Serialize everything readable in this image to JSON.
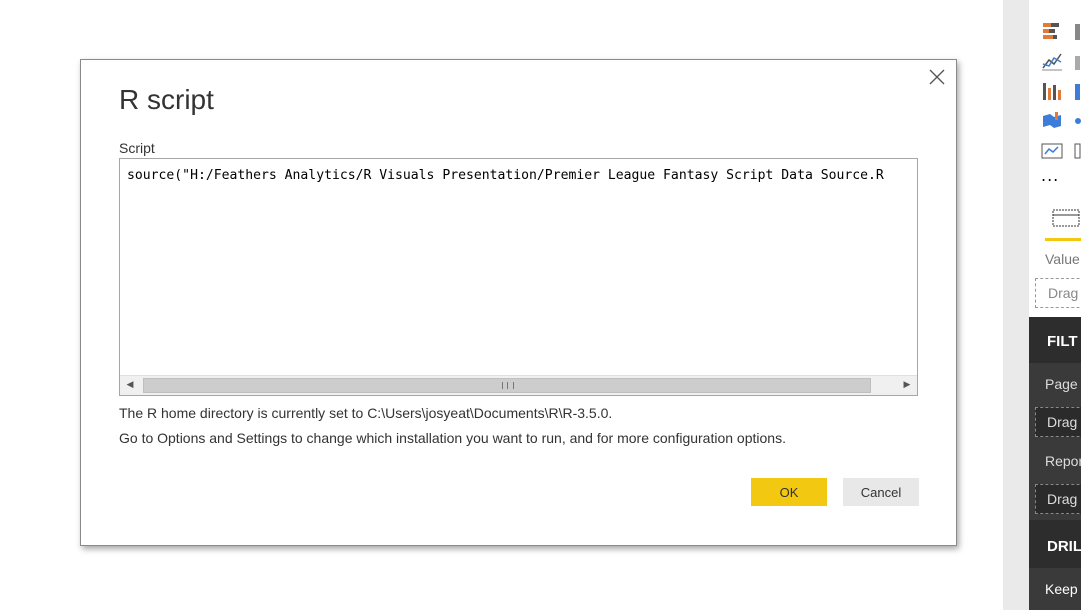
{
  "dialog": {
    "title": "R script",
    "script_label": "Script",
    "script_text": "source(\"H:/Feathers Analytics/R Visuals Presentation/Premier League Fantasy Script Data Source.R",
    "home_dir_text": "The R home directory is currently set to C:\\Users\\josyeat\\Documents\\R\\R-3.5.0.",
    "options_text": "Go to Options and Settings to change which installation you want to run, and for more configuration options.",
    "ok_label": "OK",
    "cancel_label": "Cancel",
    "close_icon": "close-icon"
  },
  "side_panel": {
    "values_label": "Value",
    "drag_label": "Drag",
    "filters_header": "FILT",
    "page_label": "Page",
    "page_drag": "Drag",
    "report_label": "Repor",
    "report_drag": "Drag",
    "drill_header": "DRIL",
    "keep_label": "Keep",
    "more_label": "...",
    "icons": [
      "stacked-bar-icon",
      "line-chart-icon",
      "ribbon-chart-icon",
      "filled-map-icon",
      "card-icon",
      "fields-icon"
    ]
  },
  "colors": {
    "accent": "#f2c811",
    "dark_panel": "#2d2d2d",
    "button_secondary": "#e8e8e8"
  }
}
